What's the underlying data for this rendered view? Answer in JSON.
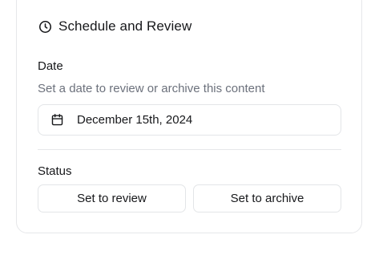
{
  "card": {
    "title": "Schedule and Review",
    "title_icon": "clock-icon"
  },
  "date_section": {
    "label": "Date",
    "description": "Set a date to review or archive this content",
    "field_icon": "calendar-icon",
    "value": "December 15th, 2024"
  },
  "status_section": {
    "label": "Status",
    "buttons": {
      "review": "Set to review",
      "archive": "Set to archive"
    }
  },
  "colors": {
    "text": "#17181b",
    "muted_text": "#6c717c",
    "border": "#e3e5e8",
    "background": "#ffffff"
  }
}
